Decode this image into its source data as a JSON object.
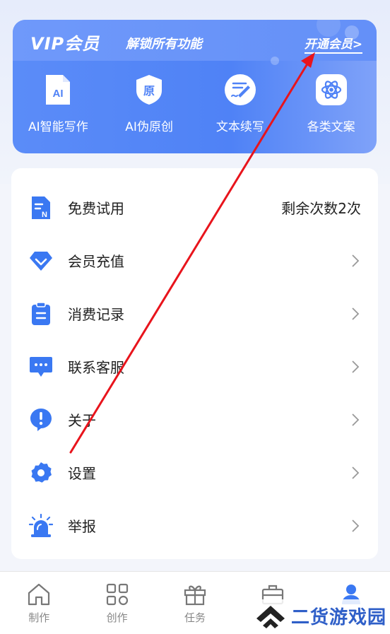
{
  "vip": {
    "title": "VIP会员",
    "subtitle": "解锁所有功能",
    "open_link": "开通会员>",
    "features": [
      {
        "label": "AI智能写作",
        "icon": "ai-doc-icon",
        "glyph": "AI"
      },
      {
        "label": "AI伪原创",
        "icon": "original-shield-icon",
        "glyph": "原"
      },
      {
        "label": "文本续写",
        "icon": "pen-writing-icon",
        "glyph": ""
      },
      {
        "label": "各类文案",
        "icon": "atom-icon",
        "glyph": ""
      }
    ]
  },
  "menu": {
    "items": [
      {
        "label": "免费试用",
        "icon": "document-n-icon",
        "right_text": "剩余次数2次"
      },
      {
        "label": "会员充值",
        "icon": "diamond-icon"
      },
      {
        "label": "消费记录",
        "icon": "clipboard-icon"
      },
      {
        "label": "联系客服",
        "icon": "chat-bubble-icon"
      },
      {
        "label": "关于",
        "icon": "info-exclamation-icon"
      },
      {
        "label": "设置",
        "icon": "gear-icon"
      },
      {
        "label": "举报",
        "icon": "alarm-siren-icon"
      }
    ]
  },
  "nav": {
    "items": [
      {
        "label": "制作",
        "icon": "home-icon"
      },
      {
        "label": "创作",
        "icon": "grid-apps-icon"
      },
      {
        "label": "任务",
        "icon": "gift-icon"
      },
      {
        "label": "",
        "icon": "briefcase-icon"
      },
      {
        "label": "",
        "icon": "user-icon"
      }
    ]
  },
  "watermark": {
    "text": "二货游戏园"
  },
  "colors": {
    "accent": "#4f82f6",
    "icon_blue": "#3a78f2",
    "annotation_arrow": "#e8141c"
  }
}
